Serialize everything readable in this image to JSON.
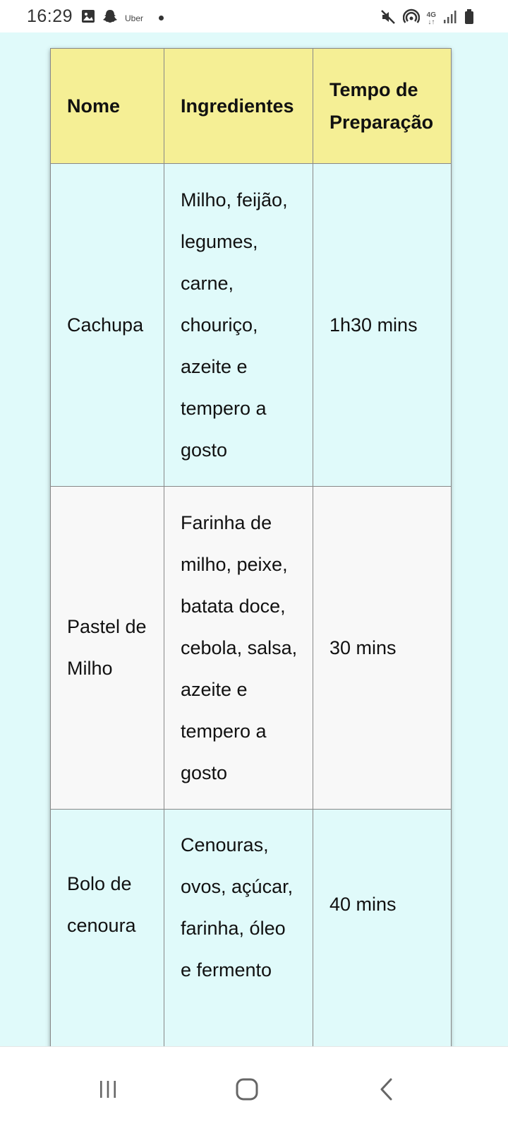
{
  "status_bar": {
    "time": "16:29",
    "left_icons": [
      "image-icon",
      "snapchat-ghost-icon",
      "uber-icon",
      "dot-icon"
    ],
    "uber_label": "Uber",
    "right_icons": [
      "mute-icon",
      "hotspot-icon",
      "network-4g-icon",
      "signal-icon",
      "battery-icon"
    ],
    "network_label": "4G"
  },
  "table": {
    "headers": [
      "Nome",
      "Ingredientes",
      "Tempo de Preparação"
    ],
    "rows": [
      {
        "nome": "Cachupa",
        "ingredientes": "Milho, feijão, legumes, carne, chouriço, azeite e tempero a gosto",
        "tempo": "1h30 mins"
      },
      {
        "nome": "Pastel de Milho",
        "ingredientes": "Farinha de milho, peixe, batata doce, cebola, salsa, azeite e tempero a gosto",
        "tempo": "30 mins"
      },
      {
        "nome": "Bolo de cenoura",
        "ingredientes": "Cenouras, ovos, açúcar, farinha, óleo e fermento",
        "tempo": "40 mins"
      }
    ],
    "colors": {
      "header_bg": "#f5ef95",
      "row_bg_a": "#e0fafa",
      "row_bg_b": "#f8f8f8"
    }
  },
  "nav_bar": {
    "buttons": [
      "recent-apps-icon",
      "home-icon",
      "back-icon"
    ]
  }
}
